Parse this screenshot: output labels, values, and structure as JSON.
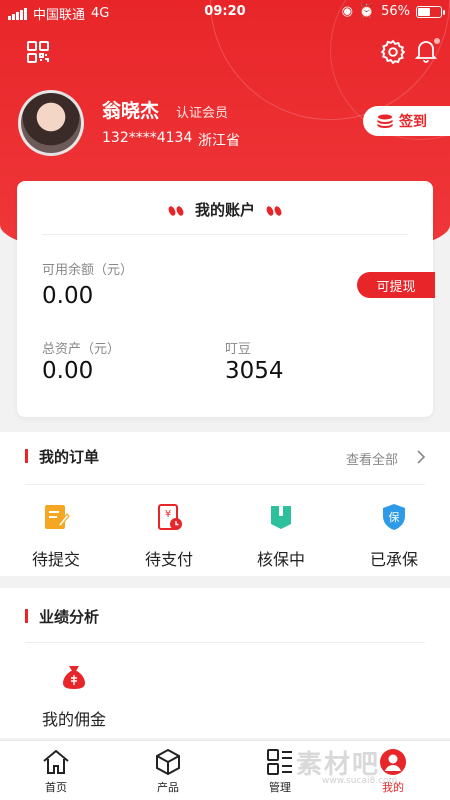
{
  "status_bar": {
    "carrier": "中国联通",
    "network": "4G",
    "time": "09:20",
    "battery": "56%",
    "battery_level": 0.56
  },
  "user": {
    "name": "翁晓杰",
    "level": "认证会员",
    "phone": "132****4134",
    "region": "浙江省",
    "signin_label": "签到"
  },
  "account": {
    "title": "我的账户",
    "available_label": "可用余额（元）",
    "available_value": "0.00",
    "withdraw_label": "可提现",
    "total_label": "总资产（元）",
    "total_value": "0.00",
    "beans_label": "叮豆",
    "beans_value": "3054"
  },
  "orders": {
    "title": "我的订单",
    "view_all": "查看全部",
    "items": [
      {
        "label": "待提交",
        "icon": "edit-document-icon"
      },
      {
        "label": "待支付",
        "icon": "payment-clock-icon"
      },
      {
        "label": "核保中",
        "icon": "review-document-icon"
      },
      {
        "label": "已承保",
        "icon": "insured-shield-icon"
      }
    ]
  },
  "performance": {
    "title": "业绩分析",
    "items": [
      {
        "label": "我的佣金",
        "icon": "money-bag-icon"
      }
    ]
  },
  "tabbar": {
    "items": [
      {
        "label": "首页",
        "icon": "home-icon",
        "active": false
      },
      {
        "label": "产品",
        "icon": "box-icon",
        "active": false
      },
      {
        "label": "管理",
        "icon": "grid-list-icon",
        "active": false
      },
      {
        "label": "我的",
        "icon": "user-icon",
        "active": true
      }
    ]
  },
  "watermark": {
    "text": "素材吧",
    "url": "www.sucai8.com"
  },
  "colors": {
    "accent": "#e8262a",
    "green": "#2cc09c",
    "blue": "#2e9be8",
    "orange": "#f5a623"
  }
}
